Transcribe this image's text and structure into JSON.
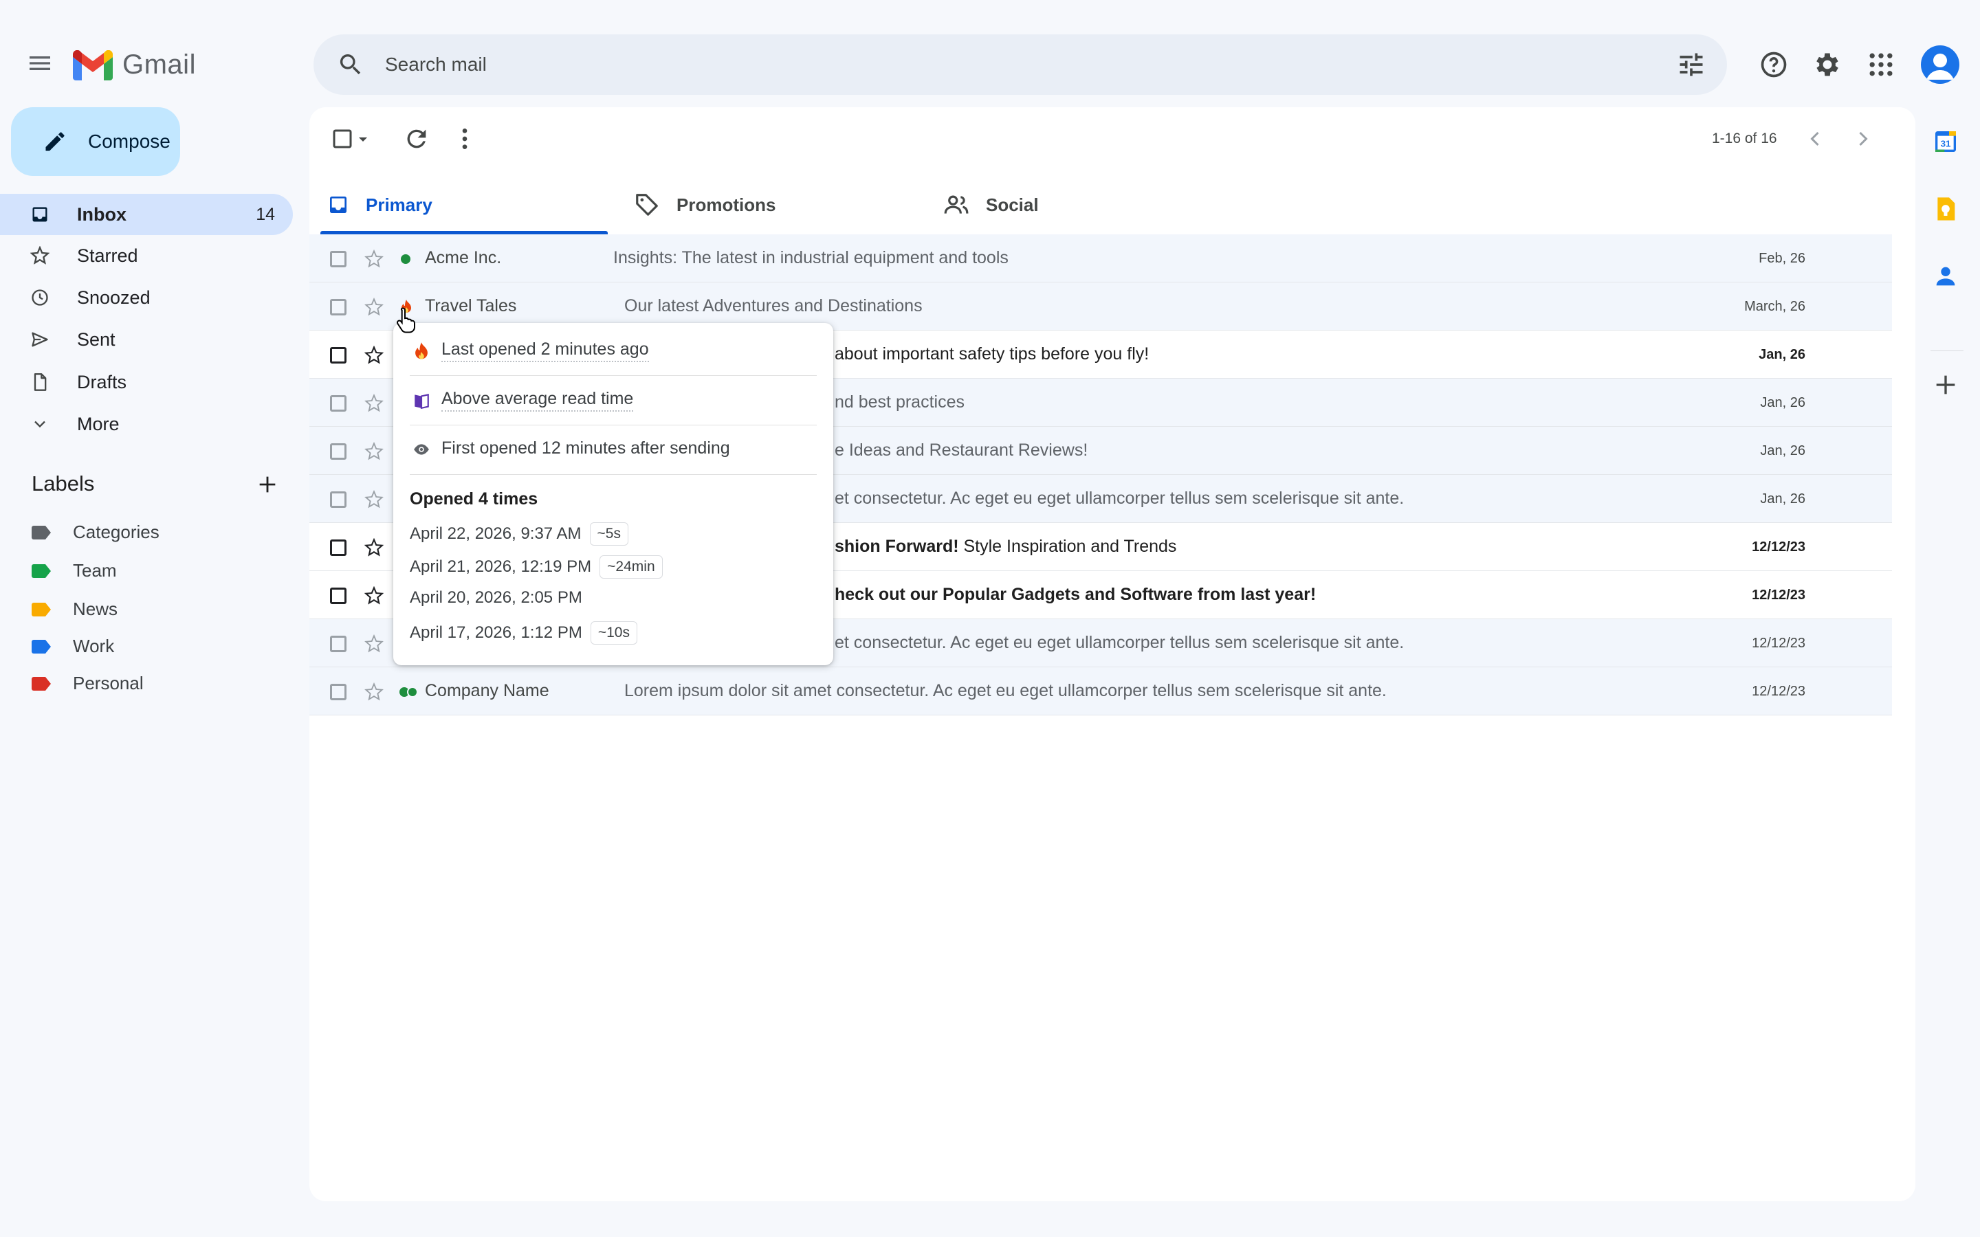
{
  "app": {
    "logo_text": "Gmail"
  },
  "search": {
    "placeholder": "Search mail"
  },
  "sidebar": {
    "compose_label": "Compose",
    "items": [
      {
        "label": "Inbox",
        "count": "14",
        "icon": "inbox-icon"
      },
      {
        "label": "Starred",
        "icon": "star-icon"
      },
      {
        "label": "Snoozed",
        "icon": "clock-icon"
      },
      {
        "label": "Sent",
        "icon": "send-icon"
      },
      {
        "label": "Drafts",
        "icon": "draft-icon"
      },
      {
        "label": "More",
        "icon": "chevron-down-icon"
      }
    ],
    "labels_title": "Labels",
    "labels": [
      {
        "label": "Categories",
        "color": "#5f6368"
      },
      {
        "label": "Team",
        "color": "#16a34a"
      },
      {
        "label": "News",
        "color": "#f9ab00"
      },
      {
        "label": "Work",
        "color": "#1a73e8"
      },
      {
        "label": "Personal",
        "color": "#d93025"
      }
    ]
  },
  "toolbar": {
    "pager": "1-16 of 16"
  },
  "tabs": [
    {
      "label": "Primary",
      "icon": "inbox-icon"
    },
    {
      "label": "Promotions",
      "icon": "tag-icon"
    },
    {
      "label": "Social",
      "icon": "people-icon"
    }
  ],
  "emails": [
    {
      "sender": "Acme Inc.",
      "subject": "Insights: The latest in industrial equipment and tools",
      "date": "Feb, 26",
      "read": true,
      "status": "green-dot"
    },
    {
      "sender": "Travel Tales",
      "subject": "Our latest Adventures and Destinations",
      "date": "March, 26",
      "read": true,
      "status": "fire"
    },
    {
      "sender": "",
      "subject_visible": "about important safety tips before you fly!",
      "date": "Jan, 26",
      "read": false
    },
    {
      "sender": "",
      "subject_visible": "nd best practices",
      "date": "Jan, 26",
      "read": true
    },
    {
      "sender": "",
      "subject_visible": "e Ideas and Restaurant Reviews!",
      "date": "Jan, 26",
      "read": true
    },
    {
      "sender": "",
      "subject_visible": "et consectetur. Ac eget eu eget ullamcorper tellus sem scelerisque sit ante.",
      "date": "Jan, 26",
      "read": true
    },
    {
      "sender": "",
      "subject_bold": "shion Forward!",
      "subject_rest": " Style Inspiration and Trends",
      "date": "12/12/23",
      "read": false
    },
    {
      "sender": "",
      "subject_visible": "heck out our Popular Gadgets and Software from last year!",
      "date": "12/12/23",
      "read": false
    },
    {
      "sender": "",
      "subject_visible": "et consectetur. Ac eget eu eget ullamcorper tellus sem scelerisque sit ante.",
      "date": "12/12/23",
      "read": true
    },
    {
      "sender": "Company Name",
      "subject": "Lorem ipsum dolor sit amet consectetur. Ac eget eu eget ullamcorper tellus sem scelerisque sit ante.",
      "date": "12/12/23",
      "read": true,
      "status": "double-green-dot"
    }
  ],
  "popover": {
    "last_opened": "Last opened 2 minutes ago",
    "read_time": "Above average read time",
    "first_opened": "First opened 12 minutes after sending",
    "opened_count": "Opened 4 times",
    "opens": [
      {
        "time": "April 22, 2026, 9:37 AM",
        "duration": "~5s"
      },
      {
        "time": "April 21, 2026, 12:19 PM",
        "duration": "~24min"
      },
      {
        "time": "April 20, 2026, 2:05 PM",
        "duration": ""
      },
      {
        "time": "April 17, 2026, 1:12 PM",
        "duration": "~10s"
      }
    ]
  },
  "colors": {
    "accent": "#0b57d0",
    "compose_bg": "#c2e7ff",
    "active_nav_bg": "#d3e3fd",
    "status_green": "#1e8e3e",
    "status_fire": "#e8430a"
  }
}
